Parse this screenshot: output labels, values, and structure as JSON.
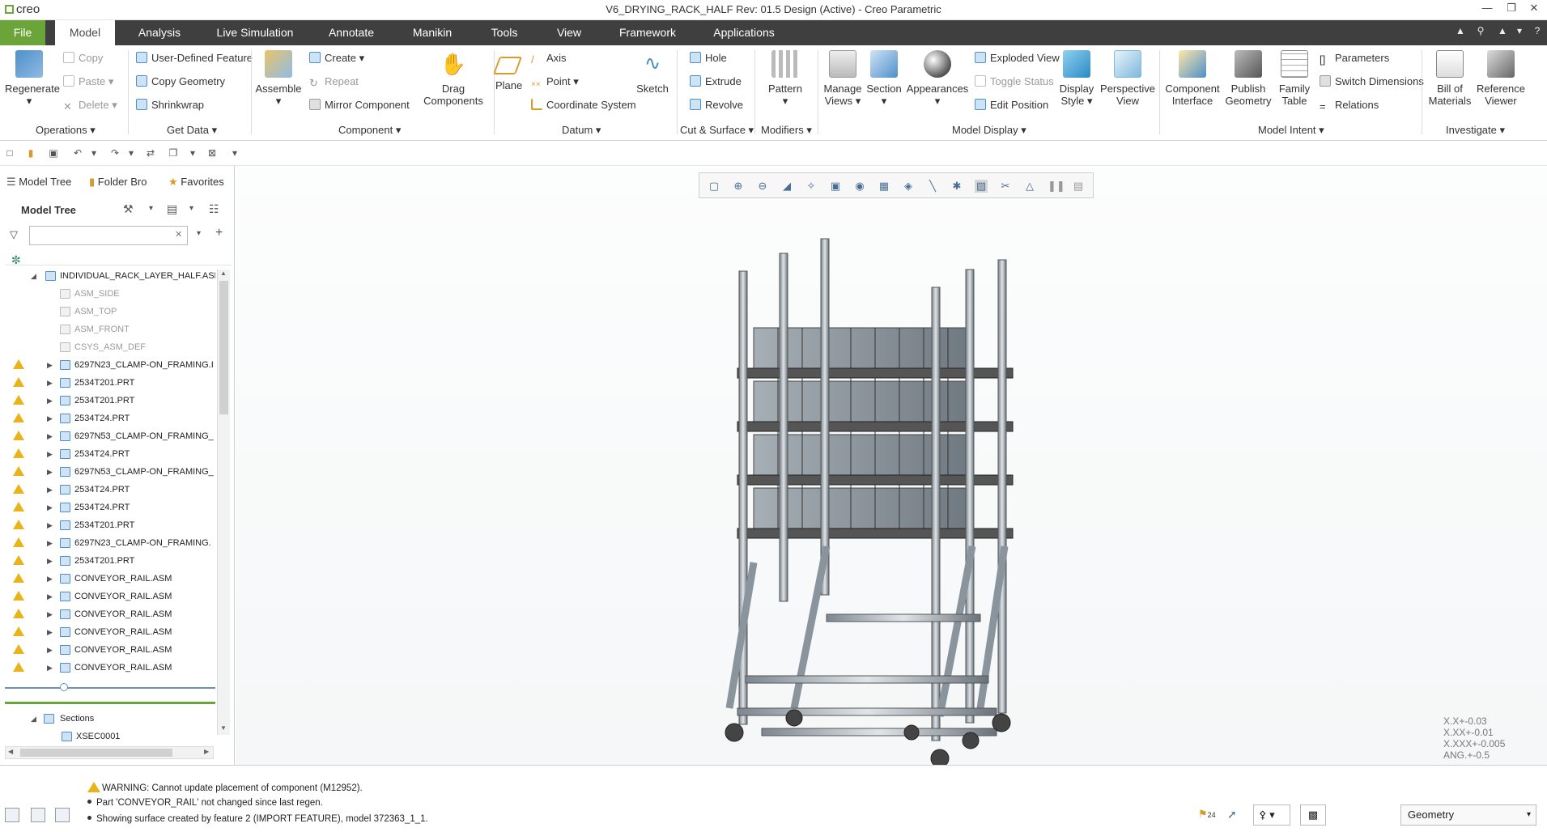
{
  "app": {
    "logo": "creo",
    "title": "V6_DRYING_RACK_HALF Rev: 01.5 Design  (Active) - Creo Parametric"
  },
  "menu": {
    "file": "File",
    "tabs": [
      "Model",
      "Analysis",
      "Live Simulation",
      "Annotate",
      "Manikin",
      "Tools",
      "View",
      "Framework",
      "Applications"
    ]
  },
  "ribbon": {
    "operations": {
      "title": "Operations",
      "regenerate": "Regenerate",
      "copy": "Copy",
      "paste": "Paste",
      "delete": "Delete"
    },
    "get_data": {
      "title": "Get Data",
      "udf": "User-Defined Feature",
      "copy_geometry": "Copy Geometry",
      "shrinkwrap": "Shrinkwrap"
    },
    "component": {
      "title": "Component",
      "assemble": "Assemble",
      "create": "Create",
      "repeat": "Repeat",
      "mirror": "Mirror Component",
      "drag": "Drag",
      "drag2": "Components"
    },
    "datum": {
      "title": "Datum",
      "plane": "Plane",
      "axis": "Axis",
      "point": "Point",
      "csys": "Coordinate System",
      "sketch": "Sketch"
    },
    "cut_surface": {
      "title": "Cut & Surface",
      "hole": "Hole",
      "extrude": "Extrude",
      "revolve": "Revolve"
    },
    "modifiers": {
      "title": "Modifiers",
      "pattern": "Pattern"
    },
    "model_display": {
      "title": "Model Display",
      "manage_views": "Manage",
      "manage_views2": "Views",
      "section": "Section",
      "appearances": "Appearances",
      "exploded": "Exploded View",
      "toggle_status": "Toggle Status",
      "edit_position": "Edit Position",
      "display_style": "Display",
      "display_style2": "Style",
      "perspective": "Perspective",
      "perspective2": "View"
    },
    "model_intent": {
      "title": "Model Intent",
      "component_interface": "Component",
      "component_interface2": "Interface",
      "publish": "Publish",
      "publish2": "Geometry",
      "family": "Family",
      "family2": "Table",
      "parameters": "Parameters",
      "switch_dims": "Switch Dimensions",
      "relations": "Relations"
    },
    "investigate": {
      "title": "Investigate",
      "bom": "Bill of",
      "bom2": "Materials",
      "ref_viewer": "Reference",
      "ref_viewer2": "Viewer"
    }
  },
  "panel": {
    "tabs": [
      "Model Tree",
      "Folder Bro",
      "Favorites"
    ],
    "header": "Model Tree",
    "search_placeholder": "",
    "tree": [
      {
        "label": "INDIVIDUAL_RACK_LAYER_HALF.ASM",
        "level": 0,
        "warn": false,
        "kind": "root"
      },
      {
        "label": "ASM_SIDE",
        "level": 1,
        "warn": false,
        "kind": "plane"
      },
      {
        "label": "ASM_TOP",
        "level": 1,
        "warn": false,
        "kind": "plane"
      },
      {
        "label": "ASM_FRONT",
        "level": 1,
        "warn": false,
        "kind": "plane"
      },
      {
        "label": "CSYS_ASM_DEF",
        "level": 1,
        "warn": false,
        "kind": "plane"
      },
      {
        "label": "6297N23_CLAMP-ON_FRAMING.I",
        "level": 1,
        "warn": true,
        "kind": "part"
      },
      {
        "label": "2534T201.PRT",
        "level": 1,
        "warn": true,
        "kind": "part"
      },
      {
        "label": "2534T201.PRT",
        "level": 1,
        "warn": true,
        "kind": "part"
      },
      {
        "label": "2534T24.PRT",
        "level": 1,
        "warn": true,
        "kind": "part"
      },
      {
        "label": "6297N53_CLAMP-ON_FRAMING_",
        "level": 1,
        "warn": true,
        "kind": "part"
      },
      {
        "label": "2534T24.PRT",
        "level": 1,
        "warn": true,
        "kind": "part"
      },
      {
        "label": "6297N53_CLAMP-ON_FRAMING_",
        "level": 1,
        "warn": true,
        "kind": "part"
      },
      {
        "label": "2534T24.PRT",
        "level": 1,
        "warn": true,
        "kind": "part"
      },
      {
        "label": "2534T24.PRT",
        "level": 1,
        "warn": true,
        "kind": "part"
      },
      {
        "label": "2534T201.PRT",
        "level": 1,
        "warn": true,
        "kind": "part"
      },
      {
        "label": "6297N23_CLAMP-ON_FRAMING.",
        "level": 1,
        "warn": true,
        "kind": "part"
      },
      {
        "label": "2534T201.PRT",
        "level": 1,
        "warn": true,
        "kind": "part"
      },
      {
        "label": "CONVEYOR_RAIL.ASM",
        "level": 1,
        "warn": true,
        "kind": "asm"
      },
      {
        "label": "CONVEYOR_RAIL.ASM",
        "level": 1,
        "warn": true,
        "kind": "asm"
      },
      {
        "label": "CONVEYOR_RAIL.ASM",
        "level": 1,
        "warn": true,
        "kind": "asm"
      },
      {
        "label": "CONVEYOR_RAIL.ASM",
        "level": 1,
        "warn": true,
        "kind": "asm"
      },
      {
        "label": "CONVEYOR_RAIL.ASM",
        "level": 1,
        "warn": true,
        "kind": "asm"
      },
      {
        "label": "CONVEYOR_RAIL.ASM",
        "level": 1,
        "warn": true,
        "kind": "asm"
      }
    ],
    "sections_label": "Sections",
    "section_item": "XSEC0001"
  },
  "tolerance": [
    "X.X+-0.03",
    "X.XX+-0.01",
    "X.XXX+-0.005",
    "ANG.+-0.5"
  ],
  "status": {
    "messages": [
      "WARNING: Cannot update placement of component (M12952).",
      "Part 'CONVEYOR_RAIL' not changed since last regen.",
      "Showing surface created by feature 2 (IMPORT FEATURE), model 372363_1_1."
    ],
    "flag_count": "24",
    "filter_value": "Geometry"
  },
  "colors": {
    "accent_green": "#6ba539",
    "menubar": "#3f3f3f",
    "warning": "#e8b31b",
    "icon_blue": "#4f8fc9"
  }
}
